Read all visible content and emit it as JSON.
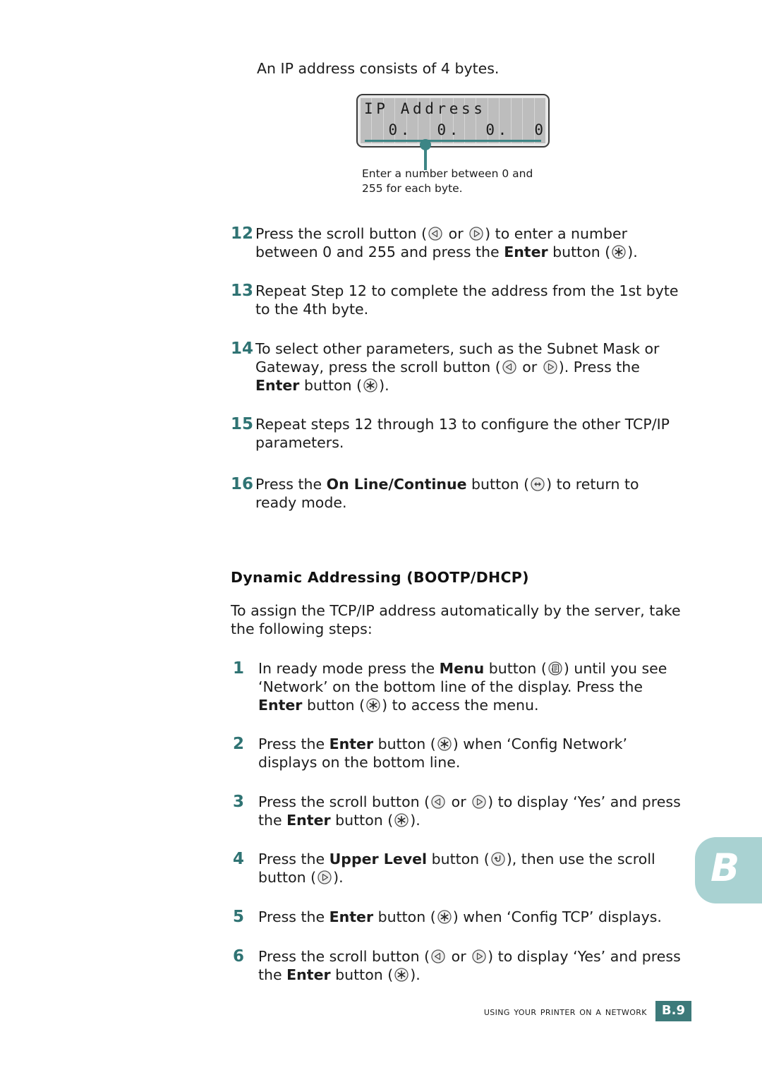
{
  "page": {
    "intro": "An IP address consists of 4 bytes."
  },
  "lcd": {
    "line1": "IP Address",
    "line2": "  0.  0.  0.  0",
    "cells": 16,
    "callout": "Enter a number between 0 and 255 for each byte.",
    "accent_color": "#3d8585",
    "panel_color": "#bdbdbd"
  },
  "steps_upper": [
    {
      "number": "12",
      "parts": [
        {
          "t": "Press the scroll button ("
        },
        {
          "icon": "scroll-left-icon"
        },
        {
          "t": " or "
        },
        {
          "icon": "scroll-right-icon"
        },
        {
          "t": ") to enter a number between 0 and 255 and press the "
        },
        {
          "t": "Enter",
          "b": true
        },
        {
          "t": " button ("
        },
        {
          "icon": "enter-icon"
        },
        {
          "t": ")."
        }
      ]
    },
    {
      "number": "13",
      "parts": [
        {
          "t": "Repeat Step 12 to complete the address from the 1st byte to the 4th byte."
        }
      ]
    },
    {
      "number": "14",
      "parts": [
        {
          "t": "To select other parameters, such as the Subnet Mask or Gateway, press the scroll button ("
        },
        {
          "icon": "scroll-left-icon"
        },
        {
          "t": " or "
        },
        {
          "icon": "scroll-right-icon"
        },
        {
          "t": "). Press the "
        },
        {
          "t": "Enter",
          "b": true
        },
        {
          "t": " button ("
        },
        {
          "icon": "enter-icon"
        },
        {
          "t": ")."
        }
      ]
    },
    {
      "number": "15",
      "parts": [
        {
          "t": "Repeat steps 12 through 13 to configure the other TCP/IP parameters."
        }
      ]
    },
    {
      "number": "16",
      "parts": [
        {
          "t": "Press the "
        },
        {
          "t": "On Line/Continue",
          "b": true
        },
        {
          "t": " button ("
        },
        {
          "icon": "online-continue-icon"
        },
        {
          "t": ") to return to ready mode."
        }
      ]
    }
  ],
  "section": {
    "heading": "Dynamic Addressing (BOOTP/DHCP)",
    "intro": "To assign the TCP/IP address automatically by the server, take the following steps:"
  },
  "steps_lower": [
    {
      "number": "1",
      "parts": [
        {
          "t": "In ready mode press the "
        },
        {
          "t": "Menu",
          "b": true
        },
        {
          "t": " button ("
        },
        {
          "icon": "menu-icon"
        },
        {
          "t": ") until you see ‘Network’ on the bottom line of the display. Press the "
        },
        {
          "t": "Enter",
          "b": true
        },
        {
          "t": " button ("
        },
        {
          "icon": "enter-icon"
        },
        {
          "t": ") to access the menu."
        }
      ]
    },
    {
      "number": "2",
      "parts": [
        {
          "t": "Press the "
        },
        {
          "t": "Enter",
          "b": true
        },
        {
          "t": " button ("
        },
        {
          "icon": "enter-icon"
        },
        {
          "t": ") when ‘Config Network’ displays on the bottom line."
        }
      ]
    },
    {
      "number": "3",
      "parts": [
        {
          "t": "Press the scroll button ("
        },
        {
          "icon": "scroll-left-icon"
        },
        {
          "t": " or "
        },
        {
          "icon": "scroll-right-icon"
        },
        {
          "t": ") to display ‘Yes’ and press the "
        },
        {
          "t": "Enter",
          "b": true
        },
        {
          "t": " button ("
        },
        {
          "icon": "enter-icon"
        },
        {
          "t": ")."
        }
      ]
    },
    {
      "number": "4",
      "parts": [
        {
          "t": "Press the "
        },
        {
          "t": "Upper Level",
          "b": true
        },
        {
          "t": " button ("
        },
        {
          "icon": "upper-level-icon"
        },
        {
          "t": "), then use the scroll button ("
        },
        {
          "icon": "scroll-right-icon"
        },
        {
          "t": ")."
        }
      ]
    },
    {
      "number": "5",
      "parts": [
        {
          "t": "Press the "
        },
        {
          "t": "Enter",
          "b": true
        },
        {
          "t": " button ("
        },
        {
          "icon": "enter-icon"
        },
        {
          "t": ") when ‘Config TCP’ displays."
        }
      ]
    },
    {
      "number": "6",
      "parts": [
        {
          "t": "Press the scroll button ("
        },
        {
          "icon": "scroll-left-icon"
        },
        {
          "t": " or "
        },
        {
          "icon": "scroll-right-icon"
        },
        {
          "t": ") to display ‘Yes’ and press the "
        },
        {
          "t": "Enter",
          "b": true
        },
        {
          "t": " button ("
        },
        {
          "icon": "enter-icon"
        },
        {
          "t": ")."
        }
      ]
    }
  ],
  "chapter_tab": {
    "letter": "B",
    "color": "#a9d2d2"
  },
  "footer": {
    "title": "Using Your Printer on a Network",
    "page": "B.9",
    "badge_color": "#3d7a7a"
  }
}
